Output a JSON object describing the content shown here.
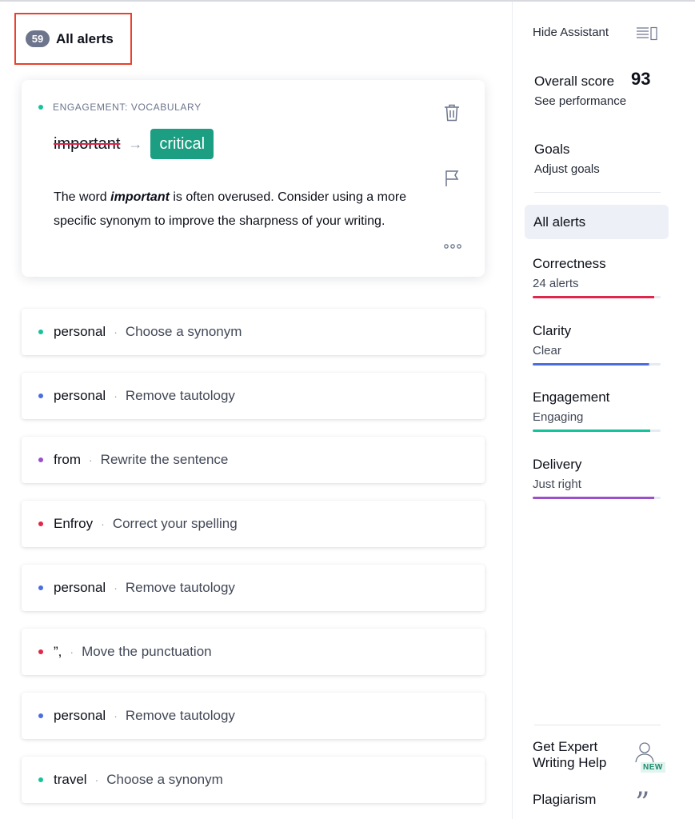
{
  "header": {
    "count": "59",
    "title": "All alerts"
  },
  "card": {
    "category": "ENGAGEMENT: VOCABULARY",
    "category_color": "#15c39a",
    "original": "important",
    "arrow": "→",
    "replacement": "critical",
    "explain_pre": "The word ",
    "explain_kw": "important",
    "explain_post": " is often overused. Consider using a more specific synonym to improve the sharpness of your writing.",
    "icons": [
      "trash-icon",
      "flag-icon",
      "more-icon"
    ]
  },
  "alerts": [
    {
      "word": "personal",
      "sep": "·",
      "desc": "Choose a synonym",
      "color": "#15c39a"
    },
    {
      "word": "personal",
      "sep": "·",
      "desc": "Remove tautology",
      "color": "#4a6ee0"
    },
    {
      "word": "from",
      "sep": "·",
      "desc": "Rewrite the sentence",
      "color": "#9b4fc9"
    },
    {
      "word": "Enfroy",
      "sep": "·",
      "desc": "Correct your spelling",
      "color": "#e0264a"
    },
    {
      "word": "personal",
      "sep": "·",
      "desc": "Remove tautology",
      "color": "#4a6ee0"
    },
    {
      "word": "”,",
      "sep": "·",
      "desc": "Move the punctuation",
      "color": "#e0264a"
    },
    {
      "word": "personal",
      "sep": "·",
      "desc": "Remove tautology",
      "color": "#4a6ee0"
    },
    {
      "word": "travel",
      "sep": "·",
      "desc": "Choose a synonym",
      "color": "#15c39a"
    }
  ],
  "sidebar": {
    "hide_label": "Hide Assistant",
    "score_label": "Overall score",
    "score_value": "93",
    "score_sub": "See performance",
    "goals_label": "Goals",
    "goals_sub": "Adjust goals",
    "all_alerts": "All alerts",
    "categories": [
      {
        "title": "Correctness",
        "sub": "24 alerts",
        "color": "#e0264a",
        "fill": 0.95
      },
      {
        "title": "Clarity",
        "sub": "Clear",
        "color": "#4a6ee0",
        "fill": 0.91
      },
      {
        "title": "Engagement",
        "sub": "Engaging",
        "color": "#15c39a",
        "fill": 0.92
      },
      {
        "title": "Delivery",
        "sub": "Just right",
        "color": "#9b4fc9",
        "fill": 0.95
      }
    ],
    "expert_line1": "Get Expert",
    "expert_line2": "Writing Help",
    "new_badge": "NEW",
    "plagiarism": "Plagiarism"
  }
}
